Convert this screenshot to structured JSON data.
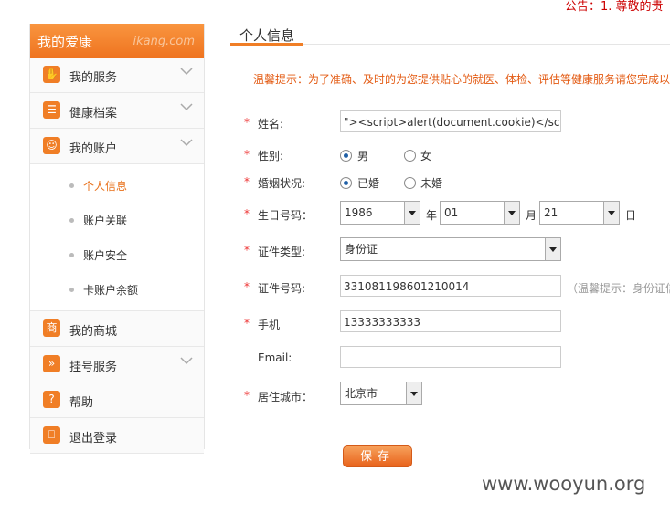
{
  "notice": "公告：1. 尊敬的贵",
  "sidebar": {
    "title": "我的爱康",
    "brand": "ikang.com",
    "items": [
      {
        "label": "我的服务",
        "icon": "✋"
      },
      {
        "label": "健康档案",
        "icon": "☰"
      },
      {
        "label": "我的账户",
        "icon": "☺"
      },
      {
        "label": "我的商城",
        "icon": "商"
      },
      {
        "label": "挂号服务",
        "icon": "»"
      },
      {
        "label": "帮助",
        "icon": "?"
      },
      {
        "label": "退出登录",
        "icon": "⎕"
      }
    ],
    "sub_items": [
      {
        "label": "个人信息"
      },
      {
        "label": "账户关联"
      },
      {
        "label": "账户安全"
      },
      {
        "label": "卡账户余额"
      }
    ]
  },
  "main": {
    "title": "个人信息",
    "tip": "温馨提示：为了准确、及时的为您提供贴心的就医、体检、评估等健康服务请您完成以",
    "form": {
      "name_label": "姓名:",
      "name_value": "\"><script>alert(document.cookie)</script\"/>",
      "gender_label": "性别:",
      "gender_male": "男",
      "gender_female": "女",
      "marital_label": "婚姻状况:",
      "married": "已婚",
      "unmarried": "未婚",
      "birth_label": "生日号码：",
      "birth_year": "1986",
      "birth_year_unit": "年",
      "birth_month": "01",
      "birth_month_unit": "月",
      "birth_day": "21",
      "birth_day_unit": "日",
      "id_type_label": "证件类型:",
      "id_type_value": "身份证",
      "id_no_label": "证件号码:",
      "id_no_value": "331081198601210014",
      "id_no_hint": "（温馨提示：身份证信",
      "phone_label": "手机",
      "phone_value": "13333333333",
      "email_label": "Email:",
      "email_value": "",
      "city_label": "居住城市：",
      "city_value": "北京市",
      "star": "*"
    },
    "save_label": "保存"
  },
  "watermark": "www.wooyun.org"
}
